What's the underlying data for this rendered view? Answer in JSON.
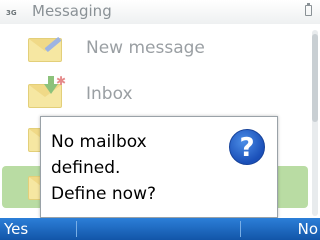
{
  "status_bar": {
    "network": "3G",
    "app_title": "Messaging"
  },
  "list": {
    "items": [
      {
        "label": "New message",
        "icon": "new-message-icon"
      },
      {
        "label": "Inbox",
        "icon": "inbox-icon"
      },
      {
        "label": "",
        "icon": "mailbox-icon"
      },
      {
        "label": "",
        "icon": "outbox-icon"
      }
    ]
  },
  "dialog": {
    "text_line1": "No mailbox defined.",
    "text_line2": "Define now?",
    "icon": "question-icon"
  },
  "softkeys": {
    "left": "Yes",
    "right": "No"
  },
  "colors": {
    "softkey_bar": "#1a63b8",
    "highlight": "#b9dca3",
    "question_icon": "#1f5ec4"
  }
}
